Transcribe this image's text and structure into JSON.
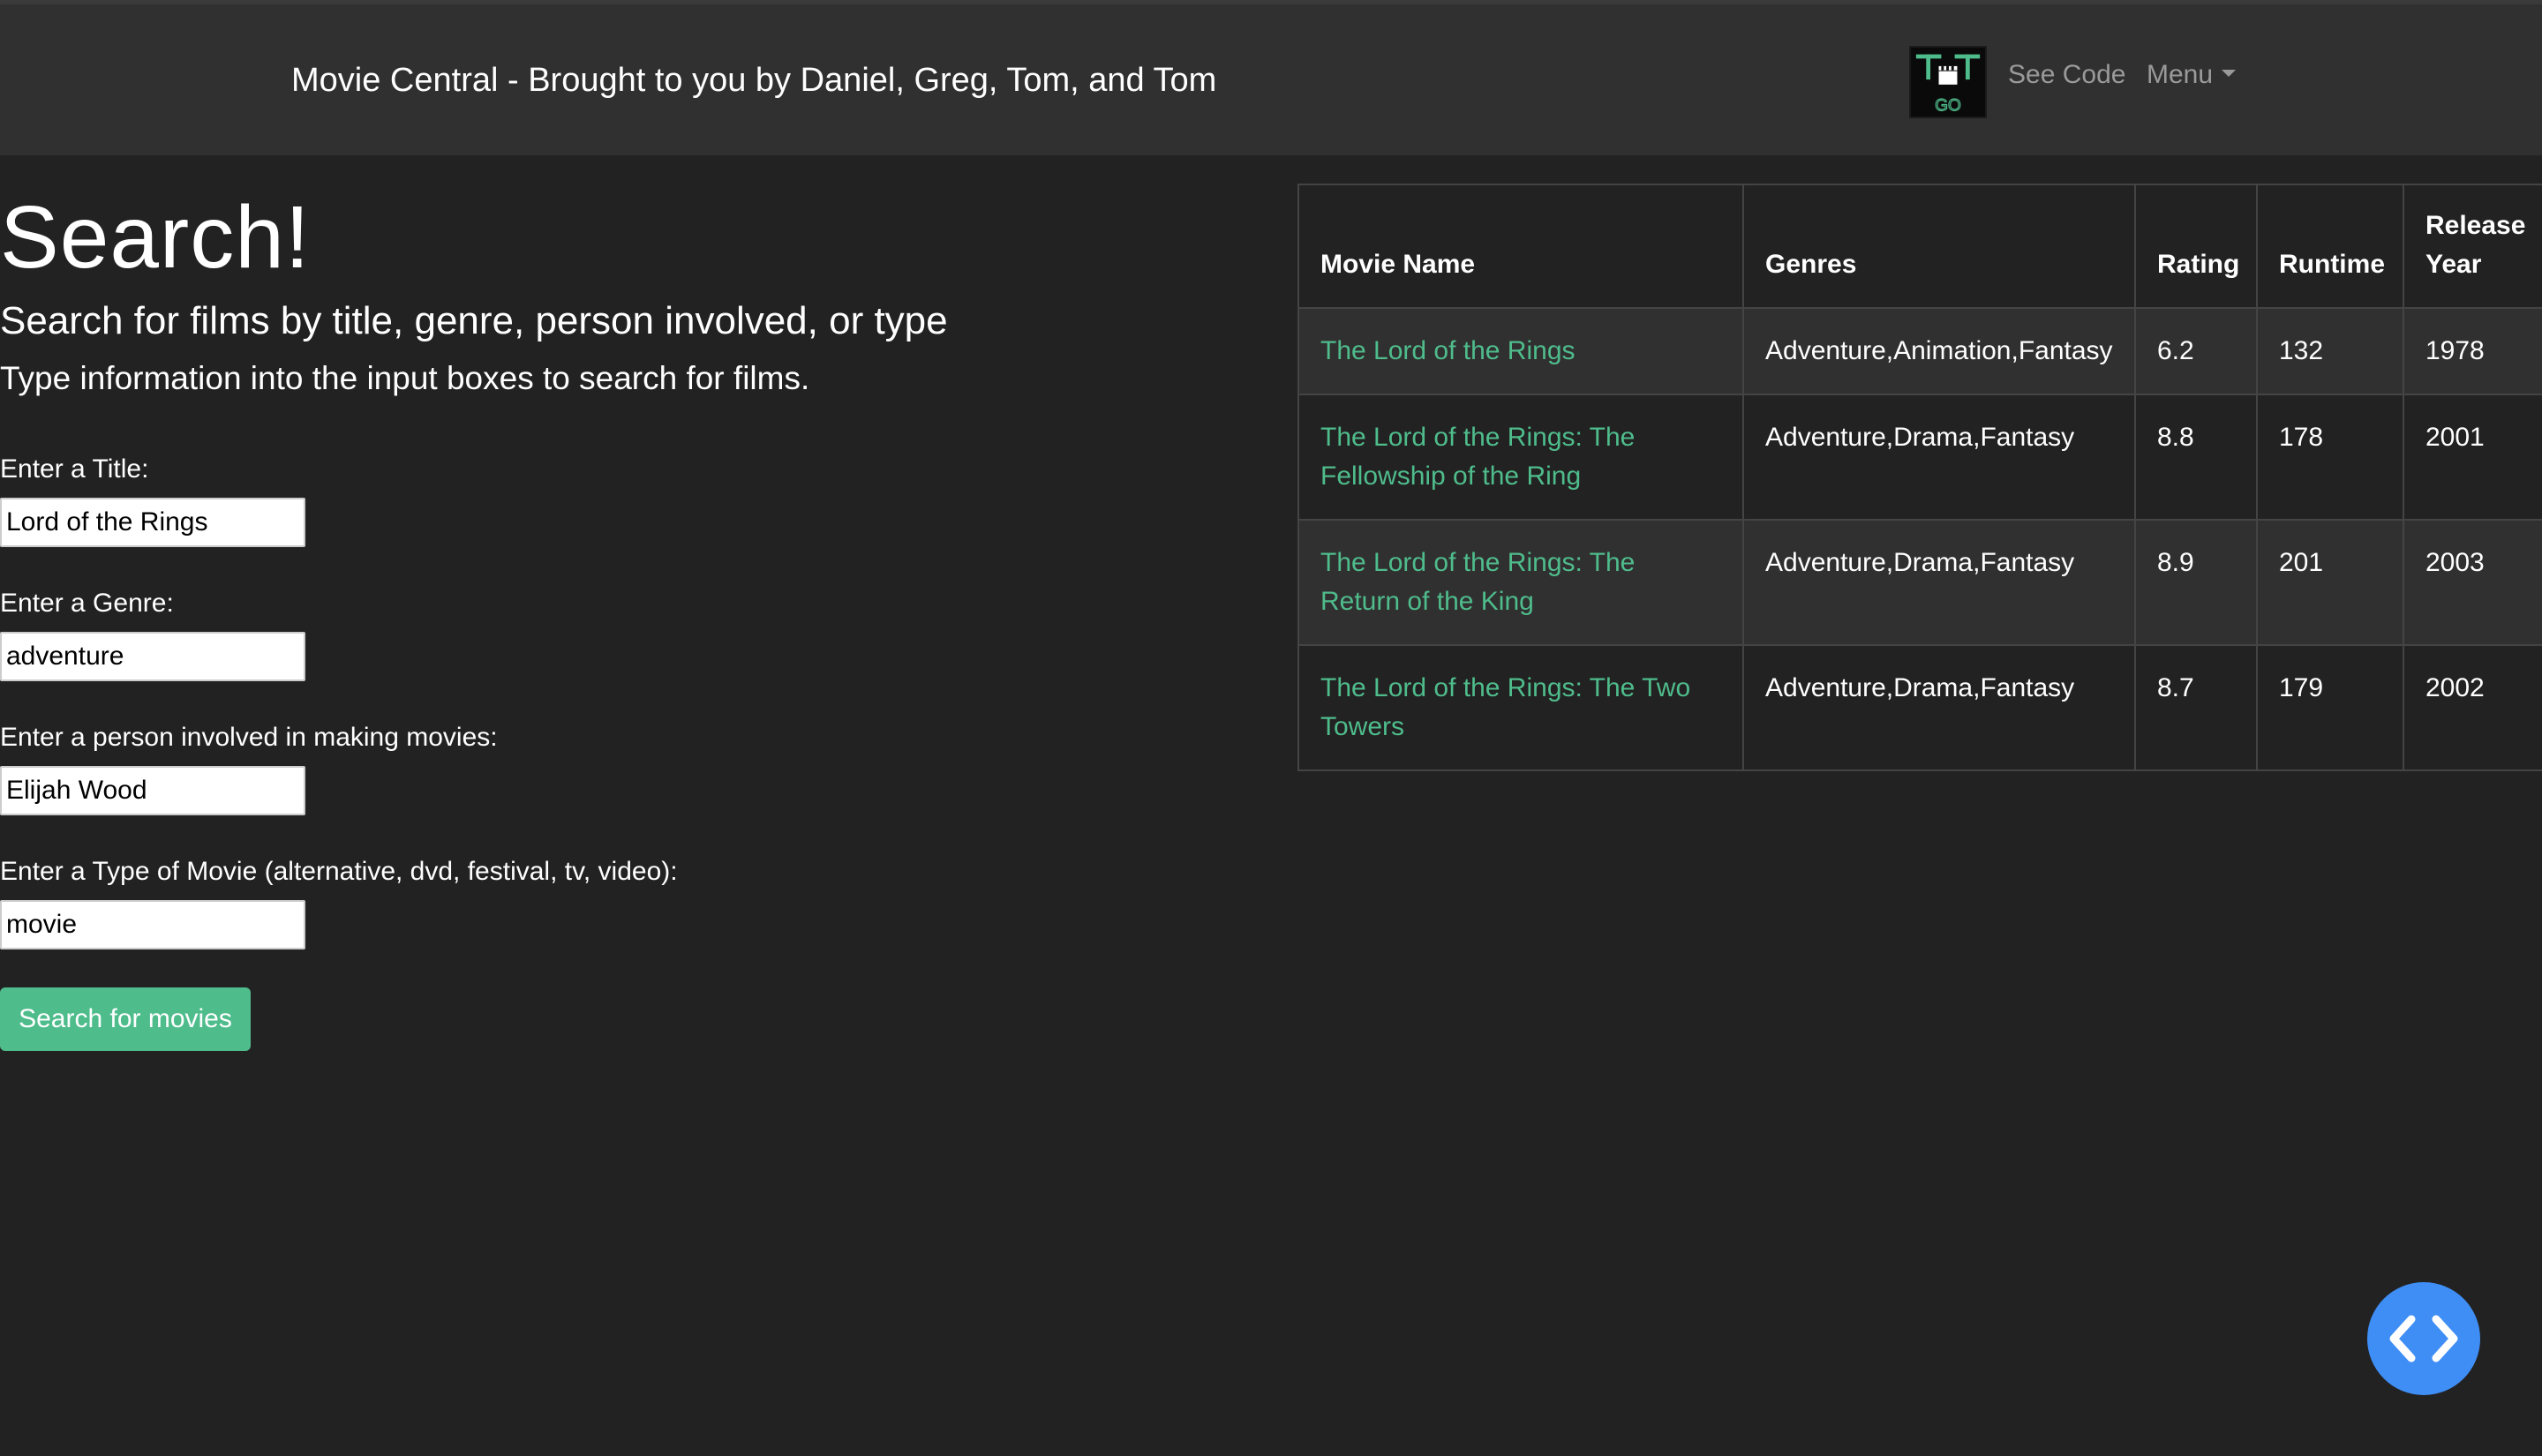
{
  "navbar": {
    "brand": "Movie Central - Brought to you by Daniel, Greg, Tom, and Tom",
    "logo_icon": "clapperboard-logo-icon",
    "logo_text": "GO",
    "see_code": "See Code",
    "menu": "Menu"
  },
  "search": {
    "title": "Search!",
    "subtitle": "Search for films by title, genre, person involved, or type",
    "instructions": "Type information into the input boxes to search for films.",
    "fields": [
      {
        "label": "Enter a Title:",
        "value": "Lord of the Rings"
      },
      {
        "label": "Enter a Genre:",
        "value": "adventure"
      },
      {
        "label": "Enter a person involved in making movies:",
        "value": "Elijah Wood"
      },
      {
        "label": "Enter a Type of Movie (alternative, dvd, festival, tv, video):",
        "value": "movie"
      }
    ],
    "button": "Search for movies"
  },
  "results": {
    "headers": [
      "Movie Name",
      "Genres",
      "Rating",
      "Runtime",
      "Release Year"
    ],
    "rows": [
      {
        "name": "The Lord of the Rings",
        "genres": "Adventure,Animation,Fantasy",
        "rating": "6.2",
        "runtime": "132",
        "year": "1978"
      },
      {
        "name": "The Lord of the Rings: The Fellowship of the Ring",
        "genres": "Adventure,Drama,Fantasy",
        "rating": "8.8",
        "runtime": "178",
        "year": "2001"
      },
      {
        "name": "The Lord of the Rings: The Return of the King",
        "genres": "Adventure,Drama,Fantasy",
        "rating": "8.9",
        "runtime": "201",
        "year": "2003"
      },
      {
        "name": "The Lord of the Rings: The Two Towers",
        "genres": "Adventure,Drama,Fantasy",
        "rating": "8.7",
        "runtime": "179",
        "year": "2002"
      }
    ]
  },
  "fab": {
    "icon": "code-brackets-icon"
  },
  "colors": {
    "background": "#222222",
    "navbar": "#303030",
    "accent": "#4fbc8c",
    "fab": "#3f8ef5"
  }
}
